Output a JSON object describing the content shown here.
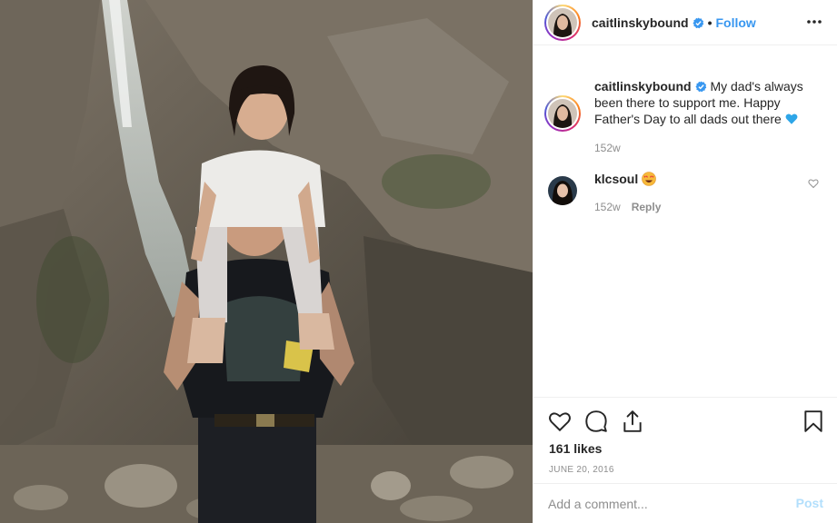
{
  "post": {
    "author": "caitlinskybound",
    "verified": true,
    "follow_label": "Follow",
    "separator": "•",
    "caption": "My dad's always been there to support me. Happy Father's Day to all dads out there",
    "caption_emoji": "blue-heart",
    "caption_age": "152w",
    "likes": "161 likes",
    "date": "JUNE 20, 2016"
  },
  "comments": [
    {
      "user": "klcsoul",
      "emoji": "heart-eyes-face",
      "age": "152w",
      "reply_label": "Reply"
    }
  ],
  "comment_box": {
    "placeholder": "Add a comment...",
    "post_label": "Post"
  },
  "icons": [
    "more-icon",
    "verified-icon",
    "like-icon",
    "comment-icon",
    "share-icon",
    "save-icon"
  ],
  "colors": {
    "link_blue": "#3897f0",
    "muted": "#8e8e8e",
    "post_disabled": "#b2dffc",
    "border": "#efefef"
  }
}
